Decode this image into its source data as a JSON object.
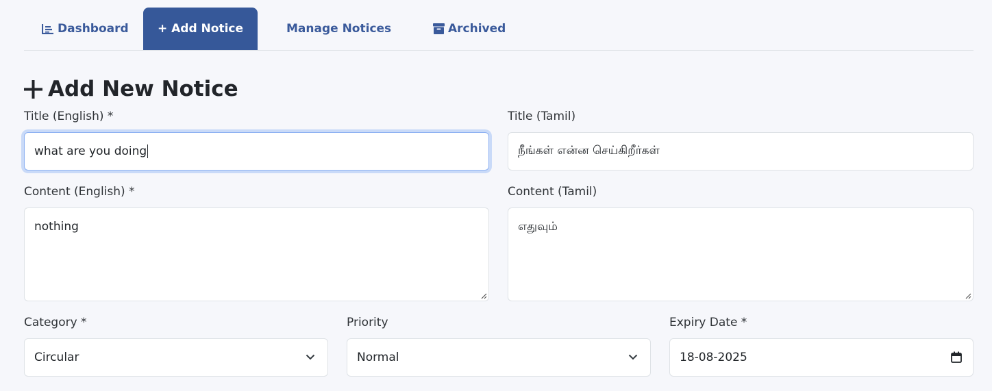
{
  "tabs": {
    "dashboard": "Dashboard",
    "add_notice": "+ Add Notice",
    "manage_notices": "Manage Notices",
    "archived": "Archived"
  },
  "page_title": "Add New Notice",
  "form": {
    "title_en": {
      "label": "Title (English) *",
      "value": "what are you doing"
    },
    "title_ta": {
      "label": "Title (Tamil)",
      "value": "நீங்கள் என்ன செய்கிறீர்கள்"
    },
    "content_en": {
      "label": "Content (English) *",
      "value": "nothing"
    },
    "content_ta": {
      "label": "Content (Tamil)",
      "value": "எதுவும்"
    },
    "category": {
      "label": "Category *",
      "value": "Circular"
    },
    "priority": {
      "label": "Priority",
      "value": "Normal"
    },
    "expiry": {
      "label": "Expiry Date *",
      "value": "18-08-2025"
    }
  },
  "colors": {
    "active_tab": "#365899",
    "tab_text": "#3a5a9b",
    "background": "#f6f7fb",
    "focus_ring": "#c9daf8"
  }
}
